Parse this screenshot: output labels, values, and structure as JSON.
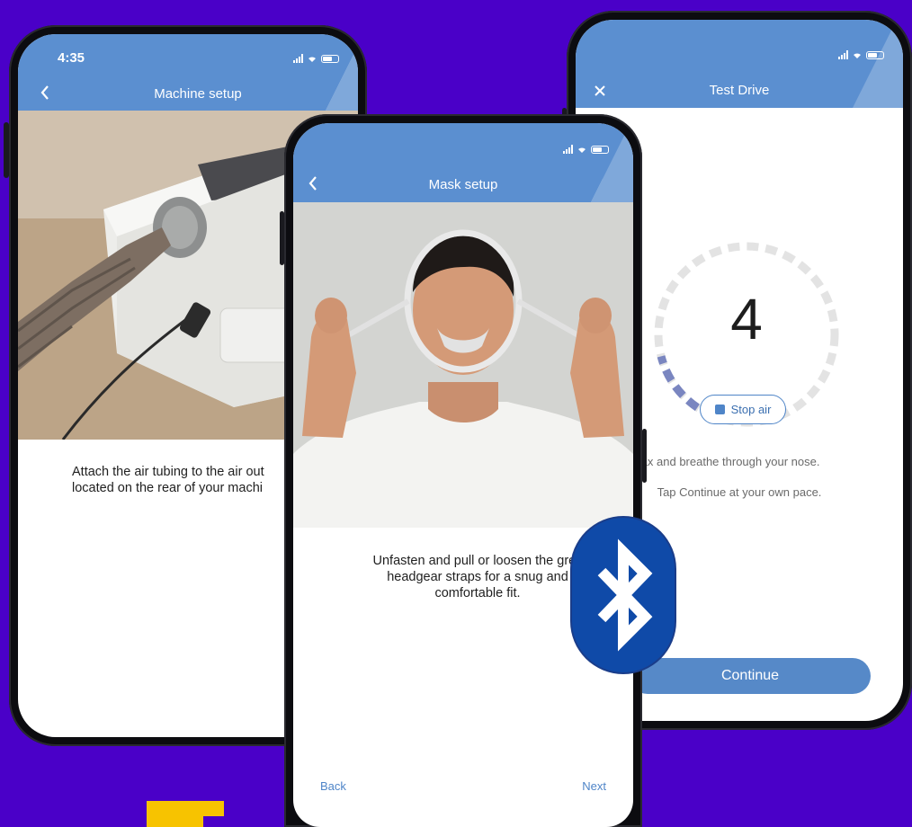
{
  "colors": {
    "background": "#4a00c8",
    "app_bar": "#5b8fd0",
    "accent_blue": "#4f85c8",
    "bluetooth_badge": "#0f4aa8",
    "yellow_block": "#f7c300"
  },
  "machine_setup": {
    "status_time": "4:35",
    "title": "Machine setup",
    "back_icon": "chevron-left-icon",
    "instruction_line1": "Attach the air tubing to the air out",
    "instruction_line2": "located on the rear of your machi"
  },
  "mask_setup": {
    "title": "Mask setup",
    "back_icon": "chevron-left-icon",
    "instruction_line1": "Unfasten and pull or loosen the grey",
    "instruction_line2": "headgear straps for a snug and",
    "instruction_line3": "comfortable fit.",
    "back_label": "Back",
    "next_label": "Next"
  },
  "test_drive": {
    "title": "Test Drive",
    "close_icon": "close-icon",
    "countdown": "4",
    "countdown_progress": 0.15,
    "stop_label": "Stop air",
    "line1": "elax and breathe through your nose.",
    "line2": "Tap Continue at your own pace.",
    "continue_label": "Continue"
  },
  "badge": {
    "icon": "bluetooth-icon"
  }
}
